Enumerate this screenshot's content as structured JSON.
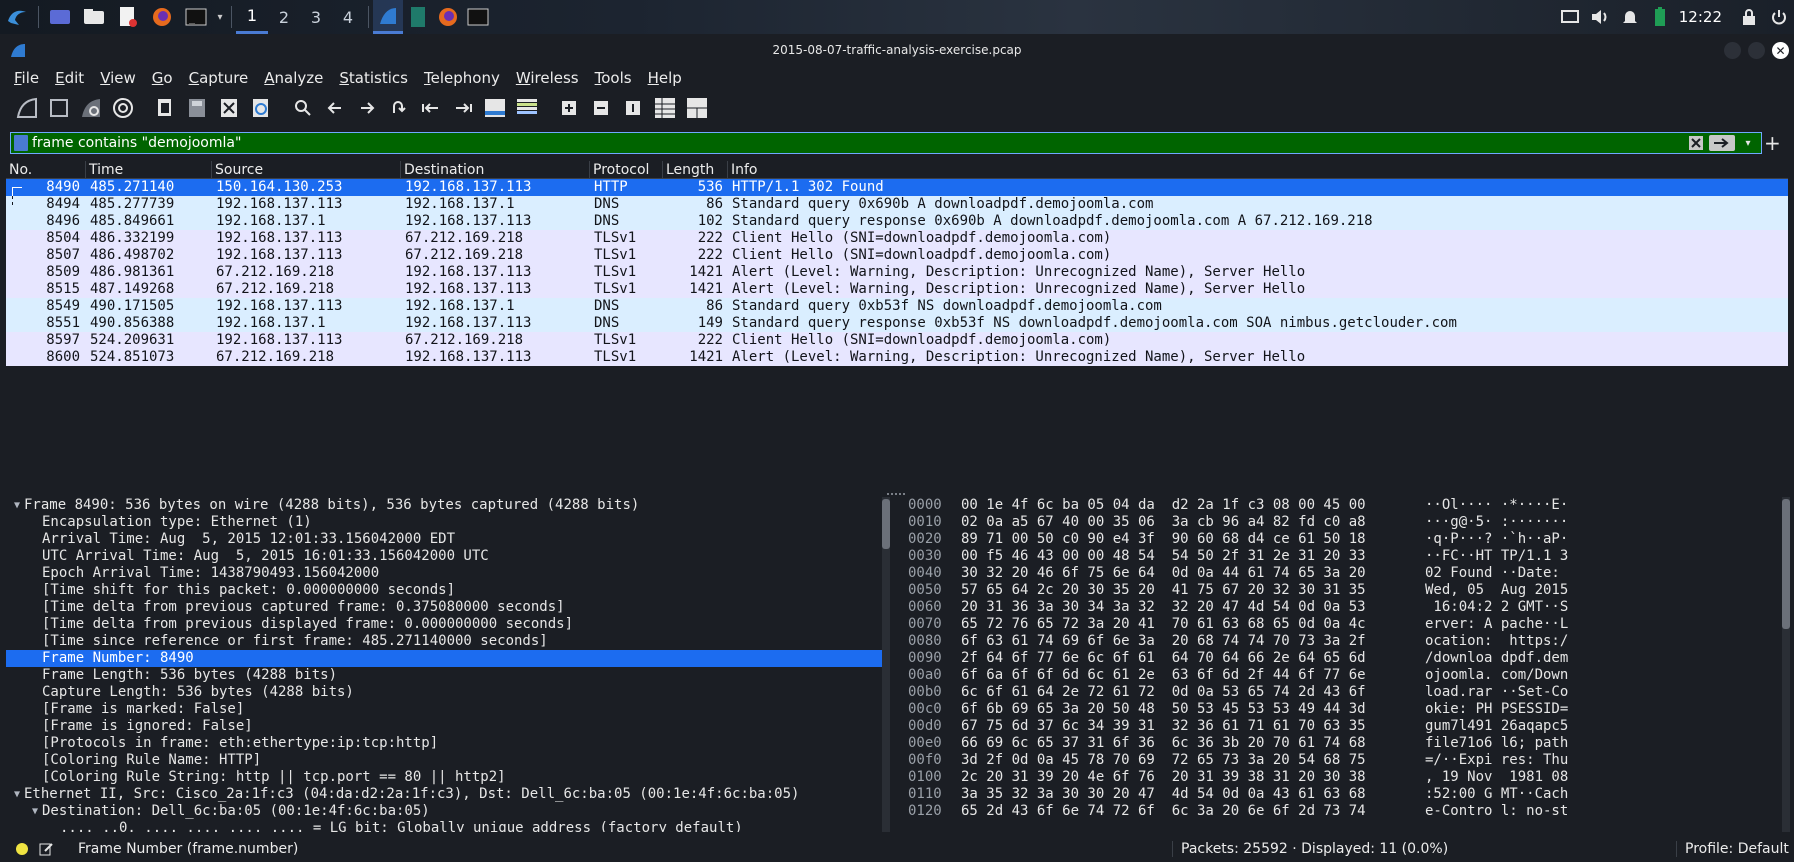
{
  "taskbar": {
    "workspaces": [
      "1",
      "2",
      "3",
      "4"
    ],
    "active_workspace": 0,
    "clock": "12:22",
    "launchers": [
      "kali-menu-icon",
      "desktop-icon",
      "file-manager-icon",
      "text-editor-icon",
      "firefox-icon",
      "terminal-icon"
    ],
    "apps": [
      "wireshark-icon",
      "notes-icon",
      "firefox-icon",
      "terminal-icon"
    ]
  },
  "window": {
    "title": "2015-08-07-traffic-analysis-exercise.pcap"
  },
  "menu": [
    "File",
    "Edit",
    "View",
    "Go",
    "Capture",
    "Analyze",
    "Statistics",
    "Telephony",
    "Wireless",
    "Tools",
    "Help"
  ],
  "filter": {
    "value": "frame contains \"demojoomla\"",
    "bg_color": "#006400"
  },
  "packet_list": {
    "columns": [
      "No.",
      "Time",
      "Source",
      "Destination",
      "Protocol",
      "Length",
      "Info"
    ],
    "rows": [
      {
        "no": "8490",
        "time": "485.271140",
        "src": "150.164.130.253",
        "dst": "192.168.137.113",
        "proto": "HTTP",
        "len": "536",
        "info": "HTTP/1.1 302 Found"
      },
      {
        "no": "8494",
        "time": "485.277739",
        "src": "192.168.137.113",
        "dst": "192.168.137.1",
        "proto": "DNS",
        "len": "86",
        "info": "Standard query 0x690b A downloadpdf.demojoomla.com"
      },
      {
        "no": "8496",
        "time": "485.849661",
        "src": "192.168.137.1",
        "dst": "192.168.137.113",
        "proto": "DNS",
        "len": "102",
        "info": "Standard query response 0x690b A downloadpdf.demojoomla.com A 67.212.169.218"
      },
      {
        "no": "8504",
        "time": "486.332199",
        "src": "192.168.137.113",
        "dst": "67.212.169.218",
        "proto": "TLSv1",
        "len": "222",
        "info": "Client Hello (SNI=downloadpdf.demojoomla.com)"
      },
      {
        "no": "8507",
        "time": "486.498702",
        "src": "192.168.137.113",
        "dst": "67.212.169.218",
        "proto": "TLSv1",
        "len": "222",
        "info": "Client Hello (SNI=downloadpdf.demojoomla.com)"
      },
      {
        "no": "8509",
        "time": "486.981361",
        "src": "67.212.169.218",
        "dst": "192.168.137.113",
        "proto": "TLSv1",
        "len": "1421",
        "info": "Alert (Level: Warning, Description: Unrecognized Name), Server Hello"
      },
      {
        "no": "8515",
        "time": "487.149268",
        "src": "67.212.169.218",
        "dst": "192.168.137.113",
        "proto": "TLSv1",
        "len": "1421",
        "info": "Alert (Level: Warning, Description: Unrecognized Name), Server Hello"
      },
      {
        "no": "8549",
        "time": "490.171505",
        "src": "192.168.137.113",
        "dst": "192.168.137.1",
        "proto": "DNS",
        "len": "86",
        "info": "Standard query 0xb53f NS downloadpdf.demojoomla.com"
      },
      {
        "no": "8551",
        "time": "490.856388",
        "src": "192.168.137.1",
        "dst": "192.168.137.113",
        "proto": "DNS",
        "len": "149",
        "info": "Standard query response 0xb53f NS downloadpdf.demojoomla.com SOA nimbus.getclouder.com"
      },
      {
        "no": "8597",
        "time": "524.209631",
        "src": "192.168.137.113",
        "dst": "67.212.169.218",
        "proto": "TLSv1",
        "len": "222",
        "info": "Client Hello (SNI=downloadpdf.demojoomla.com)"
      },
      {
        "no": "8600",
        "time": "524.851073",
        "src": "67.212.169.218",
        "dst": "192.168.137.113",
        "proto": "TLSv1",
        "len": "1421",
        "info": "Alert (Level: Warning, Description: Unrecognized Name), Server Hello"
      }
    ],
    "selected_index": 0
  },
  "details": {
    "lines": [
      {
        "indent": 0,
        "twisty": "open",
        "text": "Frame 8490: 536 bytes on wire (4288 bits), 536 bytes captured (4288 bits)"
      },
      {
        "indent": 1,
        "twisty": "",
        "text": "Encapsulation type: Ethernet (1)"
      },
      {
        "indent": 1,
        "twisty": "",
        "text": "Arrival Time: Aug  5, 2015 12:01:33.156042000 EDT"
      },
      {
        "indent": 1,
        "twisty": "",
        "text": "UTC Arrival Time: Aug  5, 2015 16:01:33.156042000 UTC"
      },
      {
        "indent": 1,
        "twisty": "",
        "text": "Epoch Arrival Time: 1438790493.156042000"
      },
      {
        "indent": 1,
        "twisty": "",
        "text": "[Time shift for this packet: 0.000000000 seconds]"
      },
      {
        "indent": 1,
        "twisty": "",
        "text": "[Time delta from previous captured frame: 0.375080000 seconds]"
      },
      {
        "indent": 1,
        "twisty": "",
        "text": "[Time delta from previous displayed frame: 0.000000000 seconds]"
      },
      {
        "indent": 1,
        "twisty": "",
        "text": "[Time since reference or first frame: 485.271140000 seconds]"
      },
      {
        "indent": 1,
        "twisty": "",
        "text": "Frame Number: 8490"
      },
      {
        "indent": 1,
        "twisty": "",
        "text": "Frame Length: 536 bytes (4288 bits)"
      },
      {
        "indent": 1,
        "twisty": "",
        "text": "Capture Length: 536 bytes (4288 bits)"
      },
      {
        "indent": 1,
        "twisty": "",
        "text": "[Frame is marked: False]"
      },
      {
        "indent": 1,
        "twisty": "",
        "text": "[Frame is ignored: False]"
      },
      {
        "indent": 1,
        "twisty": "",
        "text": "[Protocols in frame: eth:ethertype:ip:tcp:http]"
      },
      {
        "indent": 1,
        "twisty": "",
        "text": "[Coloring Rule Name: HTTP]"
      },
      {
        "indent": 1,
        "twisty": "",
        "text": "[Coloring Rule String: http || tcp.port == 80 || http2]"
      },
      {
        "indent": 0,
        "twisty": "open",
        "text": "Ethernet II, Src: Cisco_2a:1f:c3 (04:da:d2:2a:1f:c3), Dst: Dell_6c:ba:05 (00:1e:4f:6c:ba:05)"
      },
      {
        "indent": 1,
        "twisty": "open",
        "text": "Destination: Dell_6c:ba:05 (00:1e:4f:6c:ba:05)"
      },
      {
        "indent": 2,
        "twisty": "",
        "text": ".... ..0. .... .... .... .... = LG bit: Globally unique address (factory default)"
      }
    ],
    "selected_index": 9
  },
  "hex": {
    "lines": [
      {
        "off": "0000",
        "bytes": "00 1e 4f 6c ba 05 04 da  d2 2a 1f c3 08 00 45 00",
        "ascii": "··Ol···· ·*····E·"
      },
      {
        "off": "0010",
        "bytes": "02 0a a5 67 40 00 35 06  3a cb 96 a4 82 fd c0 a8",
        "ascii": "···g@·5· :·······"
      },
      {
        "off": "0020",
        "bytes": "89 71 00 50 c0 90 e4 3f  90 60 68 d4 ce 61 50 18",
        "ascii": "·q·P···? ·`h··aP·"
      },
      {
        "off": "0030",
        "bytes": "00 f5 46 43 00 00 48 54  54 50 2f 31 2e 31 20 33",
        "ascii": "··FC··HT TP/1.1 3"
      },
      {
        "off": "0040",
        "bytes": "30 32 20 46 6f 75 6e 64  0d 0a 44 61 74 65 3a 20",
        "ascii": "02 Found ··Date: "
      },
      {
        "off": "0050",
        "bytes": "57 65 64 2c 20 30 35 20  41 75 67 20 32 30 31 35",
        "ascii": "Wed, 05  Aug 2015"
      },
      {
        "off": "0060",
        "bytes": "20 31 36 3a 30 34 3a 32  32 20 47 4d 54 0d 0a 53",
        "ascii": " 16:04:2 2 GMT··S"
      },
      {
        "off": "0070",
        "bytes": "65 72 76 65 72 3a 20 41  70 61 63 68 65 0d 0a 4c",
        "ascii": "erver: A pache··L"
      },
      {
        "off": "0080",
        "bytes": "6f 63 61 74 69 6f 6e 3a  20 68 74 74 70 73 3a 2f",
        "ascii": "ocation:  https:/"
      },
      {
        "off": "0090",
        "bytes": "2f 64 6f 77 6e 6c 6f 61  64 70 64 66 2e 64 65 6d",
        "ascii": "/downloa dpdf.dem"
      },
      {
        "off": "00a0",
        "bytes": "6f 6a 6f 6f 6d 6c 61 2e  63 6f 6d 2f 44 6f 77 6e",
        "ascii": "ojoomla. com/Down"
      },
      {
        "off": "00b0",
        "bytes": "6c 6f 61 64 2e 72 61 72  0d 0a 53 65 74 2d 43 6f",
        "ascii": "load.rar ··Set-Co"
      },
      {
        "off": "00c0",
        "bytes": "6f 6b 69 65 3a 20 50 48  50 53 45 53 53 49 44 3d",
        "ascii": "okie: PH PSESSID="
      },
      {
        "off": "00d0",
        "bytes": "67 75 6d 37 6c 34 39 31  32 36 61 71 61 70 63 35",
        "ascii": "gum7l491 26aqapc5"
      },
      {
        "off": "00e0",
        "bytes": "66 69 6c 65 37 31 6f 36  6c 36 3b 20 70 61 74 68",
        "ascii": "file71o6 l6; path"
      },
      {
        "off": "00f0",
        "bytes": "3d 2f 0d 0a 45 78 70 69  72 65 73 3a 20 54 68 75",
        "ascii": "=/··Expi res: Thu"
      },
      {
        "off": "0100",
        "bytes": "2c 20 31 39 20 4e 6f 76  20 31 39 38 31 20 30 38",
        "ascii": ", 19 Nov  1981 08"
      },
      {
        "off": "0110",
        "bytes": "3a 35 32 3a 30 30 20 47  4d 54 0d 0a 43 61 63 68",
        "ascii": ":52:00 G MT··Cach"
      },
      {
        "off": "0120",
        "bytes": "65 2d 43 6f 6e 74 72 6f  6c 3a 20 6e 6f 2d 73 74",
        "ascii": "e-Contro l: no-st"
      }
    ]
  },
  "status": {
    "field": "Frame Number (frame.number)",
    "packets": "Packets: 25592 · Displayed: 11 (0.0%)",
    "profile": "Profile: Default"
  },
  "colors": {
    "dns_row": "#daeeff",
    "tls_row": "#e7e6ff",
    "http_row": "#e4ffc7",
    "selection": "#1c6cf0",
    "filter_valid": "#006400"
  }
}
